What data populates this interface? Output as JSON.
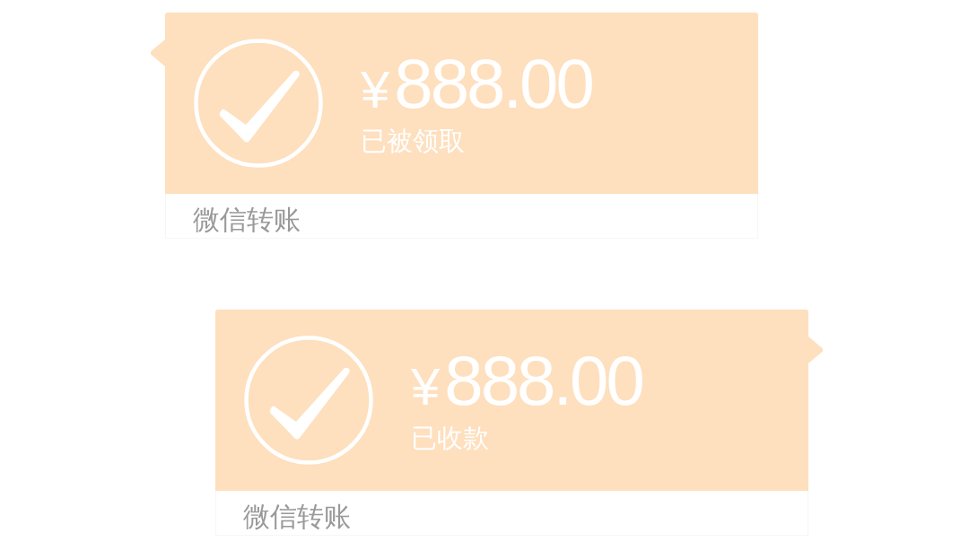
{
  "messages": [
    {
      "kind": "incoming",
      "currency": "¥",
      "amount": "888.00",
      "status": "已被领取",
      "footer": "微信转账"
    },
    {
      "kind": "outgoing",
      "currency": "¥",
      "amount": "888.00",
      "status": "已收款",
      "footer": "微信转账"
    }
  ]
}
